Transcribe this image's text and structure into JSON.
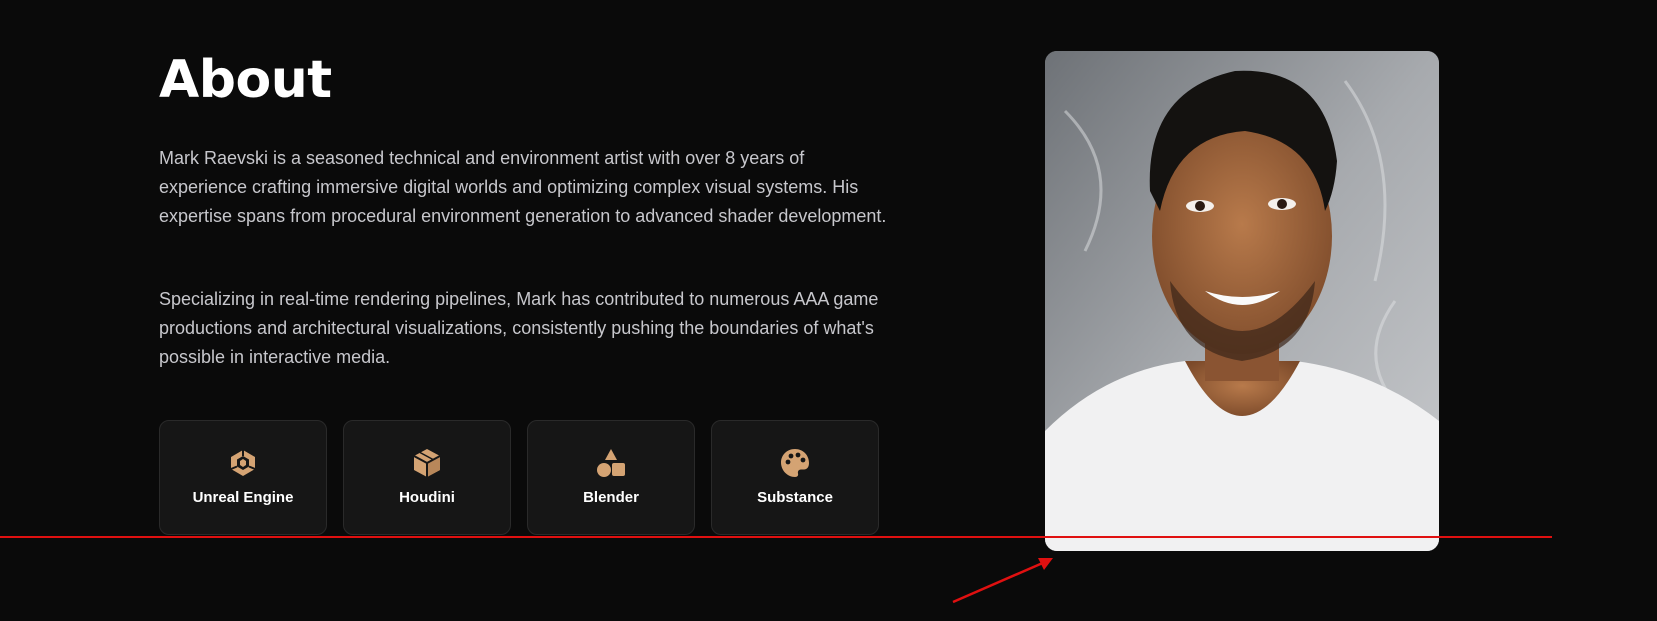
{
  "about": {
    "title": "About",
    "paragraph_1": "Mark Raevski is a seasoned technical and environment artist with over 8 years of experience crafting immersive digital worlds and optimizing complex visual systems. His expertise spans from procedural environment generation to advanced shader development.",
    "paragraph_2": "Specializing in real-time rendering pipelines, Mark has contributed to numerous AAA game productions and architectural visualizations, consistently pushing the boundaries of what's possible in interactive media."
  },
  "skills": [
    {
      "label": "Unreal Engine",
      "icon": "unreal-engine-icon"
    },
    {
      "label": "Houdini",
      "icon": "cube-icon"
    },
    {
      "label": "Blender",
      "icon": "shapes-icon"
    },
    {
      "label": "Substance",
      "icon": "palette-icon"
    }
  ],
  "colors": {
    "background": "#0a0a0a",
    "card": "#161616",
    "accent": "#d4a373",
    "annotation": "#e01010"
  }
}
